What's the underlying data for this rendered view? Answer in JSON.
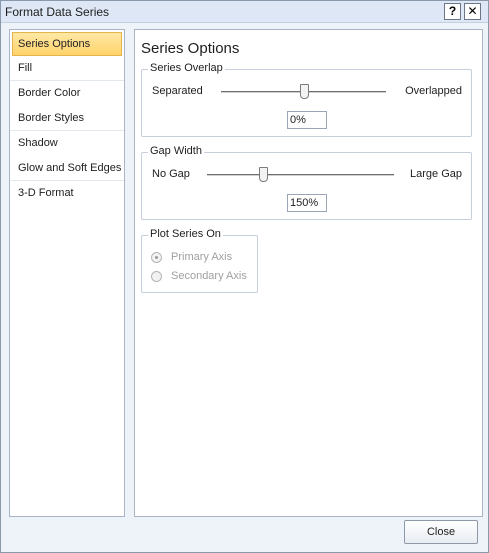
{
  "window": {
    "title": "Format Data Series",
    "help_label": "?",
    "close_label": "✕"
  },
  "nav": {
    "items": [
      {
        "label": "Series Options",
        "selected": true
      },
      {
        "label": "Fill"
      },
      {
        "label": "Border Color"
      },
      {
        "label": "Border Styles"
      },
      {
        "label": "Shadow"
      },
      {
        "label": "Glow and Soft Edges"
      },
      {
        "label": "3-D Format"
      }
    ]
  },
  "panel": {
    "title": "Series Options",
    "series_overlap": {
      "label": "Series Overlap",
      "left_label": "Separated",
      "right_label": "Overlapped",
      "value": "0%",
      "slider_fraction": 0.5
    },
    "gap_width": {
      "label": "Gap Width",
      "left_label": "No Gap",
      "right_label": "Large Gap",
      "value": "150%",
      "slider_fraction": 0.3
    },
    "plot_series_on": {
      "label": "Plot Series On",
      "options": [
        {
          "label": "Primary Axis",
          "checked": true,
          "disabled": true
        },
        {
          "label": "Secondary Axis",
          "checked": false,
          "disabled": true
        }
      ]
    }
  },
  "footer": {
    "close_button": "Close"
  },
  "icons": {
    "help": "help-icon",
    "close": "close-icon",
    "radio": "radio-icon"
  },
  "colors": {
    "selected_nav": "#ffd36a",
    "titlebar": "#dde7f5"
  }
}
